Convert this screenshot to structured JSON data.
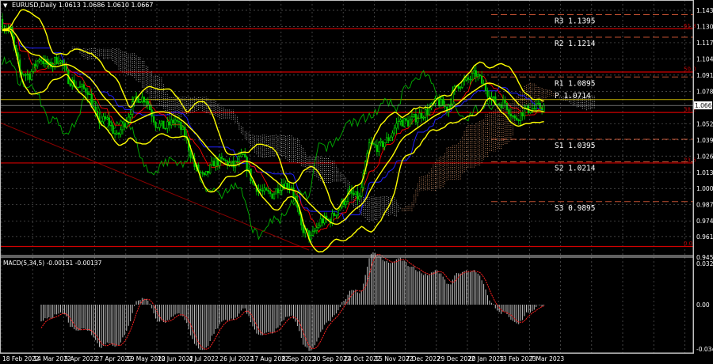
{
  "header": {
    "symbol": "EURUSD,Daily",
    "open": "1.0613",
    "high": "1.0686",
    "low": "1.0610",
    "close": "1.0667"
  },
  "macd_header": {
    "name": "MACD(5,34,5)",
    "main": "-0.00151",
    "signal": "-0.00137"
  },
  "current_price_label": "1.0667",
  "colors": {
    "background": "#000000",
    "candle_up": "#00ff00",
    "candle_down": "#00c800",
    "bollinger": "#ffff00",
    "tenkan": "#ff0000",
    "kijun": "#2020ff",
    "chikou": "#00b000",
    "cloud_bull": "#d8956a",
    "cloud_bear": "#c8c8c8",
    "fib": "#d00000",
    "pivot": "#c05030",
    "pivot_p": "#c8b400",
    "macd_hist": "#c0c0c0",
    "macd_signal": "#ff2020",
    "grid": "#5a5a5a"
  },
  "price_axis": [
    "1.1430",
    "1.1300",
    "1.1170",
    "1.1040",
    "1.0910",
    "1.0780",
    "1.0520",
    "1.0390",
    "1.0260",
    "1.0130",
    "1.0000",
    "0.9870",
    "0.9740",
    "0.9615",
    "0.9450"
  ],
  "macd_axis": [
    "0.03226",
    "0.00",
    "-0.03463"
  ],
  "time_axis": [
    "18 Feb 2022",
    "14 Mar 2022",
    "5 Apr 2022",
    "27 Apr 2022",
    "19 May 2022",
    "10 Jun 2022",
    "4 Jul 2022",
    "26 Jul 2022",
    "17 Aug 2022",
    "8 Sep 2022",
    "30 Sep 2022",
    "24 Oct 2022",
    "15 Nov 2022",
    "7 Dec 2022",
    "29 Dec 2022",
    "20 Jan 2023",
    "13 Feb 2023",
    "7 Mar 2023"
  ],
  "fib_levels": [
    {
      "label": "61.8",
      "price": 1.1282
    },
    {
      "label": "50.0",
      "price": 1.0935
    },
    {
      "label": "38.2",
      "price": 1.061
    },
    {
      "label": "23.6",
      "price": 1.0205
    },
    {
      "label": "0.0",
      "price": 0.9535
    }
  ],
  "pivots": [
    {
      "name": "R3",
      "value": "1.1395"
    },
    {
      "name": "R2",
      "value": "1.1214"
    },
    {
      "name": "R1",
      "value": "1.0895"
    },
    {
      "name": "P",
      "value": "1.0714"
    },
    {
      "name": "S1",
      "value": "1.0395"
    },
    {
      "name": "S2",
      "value": "1.0214"
    },
    {
      "name": "S3",
      "value": "0.9895"
    }
  ],
  "chart_data": {
    "type": "candlestick",
    "title": "EURUSD,Daily",
    "indicators": [
      "Bollinger Bands(20,2)",
      "Ichimoku(9,26,52)",
      "MACD(5,34,5)",
      "Pivot levels",
      "Fibonacci retracement"
    ],
    "x_range": [
      "18 Feb 2022",
      "15 Mar 2023"
    ],
    "ylim": [
      0.945,
      1.143
    ],
    "bars_per_step": 5,
    "weekly_closes": [
      1.132,
      1.127,
      1.093,
      1.091,
      1.105,
      1.098,
      1.105,
      1.088,
      1.081,
      1.079,
      1.054,
      1.055,
      1.041,
      1.056,
      1.073,
      1.072,
      1.052,
      1.049,
      1.055,
      1.043,
      1.018,
      1.008,
      1.021,
      1.022,
      1.018,
      1.026,
      1.004,
      0.997,
      0.995,
      1.004,
      1.002,
      0.969,
      0.96,
      0.974,
      0.975,
      0.986,
      0.996,
      0.992,
      1.035,
      1.033,
      1.04,
      1.054,
      1.053,
      1.058,
      1.062,
      1.07,
      1.064,
      1.083,
      1.086,
      1.092,
      1.08,
      1.068,
      1.069,
      1.055,
      1.063,
      1.064,
      1.0667
    ],
    "macd_ylim": [
      -0.03463,
      0.03226
    ]
  }
}
